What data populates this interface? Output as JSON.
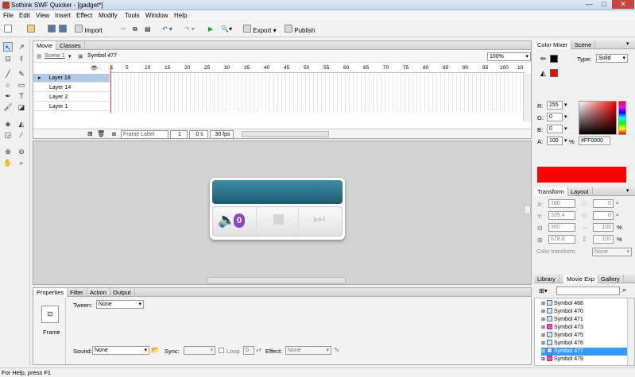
{
  "window": {
    "title": "Sothink SWF Quicker - [gadget*]",
    "min": "—",
    "max": "□",
    "close": "✕"
  },
  "menu": [
    "File",
    "Edit",
    "View",
    "Insert",
    "Effect",
    "Modify",
    "Tools",
    "Window",
    "Help"
  ],
  "toolbar": {
    "import": "Import",
    "export": "Export",
    "publish": "Publish"
  },
  "movie_tabs": {
    "movie": "Movie",
    "classes": "Classes"
  },
  "breadcrumb": {
    "scene": "Scene 1",
    "symbol": "Symbol 477"
  },
  "zoom": "100%",
  "timeline": {
    "ruler": [
      "1",
      "5",
      "10",
      "15",
      "20",
      "25",
      "30",
      "35",
      "40",
      "45",
      "50",
      "55",
      "60",
      "65",
      "70",
      "75",
      "80",
      "85",
      "90",
      "95",
      "100",
      "10"
    ],
    "layers": [
      "Layer 18",
      "Layer 14",
      "Layer 2",
      "Layer 1"
    ],
    "frame_label": "Frame Label",
    "frame_num": "1",
    "time": "0 s",
    "fps": "30 fps"
  },
  "properties": {
    "tabs": [
      "Properties",
      "Filter",
      "Action",
      "Output"
    ],
    "frame_label": "Frame",
    "tween_label": "Tween:",
    "tween_value": "None",
    "sound_label": "Sound:",
    "sound_value": "None",
    "sync_label": "Sync:",
    "loop_label": "Loop",
    "loop_count": "0",
    "effect_label": "Effect:",
    "effect_value": "None"
  },
  "color_mixer": {
    "tabs": [
      "Color Mixer",
      "Scene"
    ],
    "type_label": "Type:",
    "type_value": "Solid",
    "r_label": "R:",
    "r": "255",
    "g_label": "G:",
    "g": "0",
    "b_label": "B:",
    "b": "0",
    "a_label": "A:",
    "a": "100",
    "pct": "%",
    "hex": "#FF0000",
    "swatch": "#ff0000"
  },
  "transform": {
    "tabs": [
      "Transform",
      "Layout"
    ],
    "x_label": "X:",
    "x": "180",
    "y_label": "Y:",
    "y": "339.4",
    "w": "360",
    "h": "678.8",
    "skew1": "0",
    "skew2": "0",
    "scale1": "100",
    "scale2": "100",
    "color_transform_label": "Color transform:",
    "color_transform_value": "None"
  },
  "library": {
    "tabs": [
      "Library",
      "Movie Exp",
      "Gallery"
    ],
    "items": [
      {
        "name": "Symbol 468",
        "selected": false
      },
      {
        "name": "Symbol 470",
        "selected": false
      },
      {
        "name": "Symbol 471",
        "selected": false
      },
      {
        "name": "Symbol 473",
        "selected": false
      },
      {
        "name": "Symbol 475",
        "selected": false
      },
      {
        "name": "Symbol 476",
        "selected": false
      },
      {
        "name": "Symbol 477",
        "selected": true
      },
      {
        "name": "Symbol 479",
        "selected": false
      }
    ]
  },
  "widget": {
    "badge": "0"
  },
  "status": "For Help, press F1"
}
